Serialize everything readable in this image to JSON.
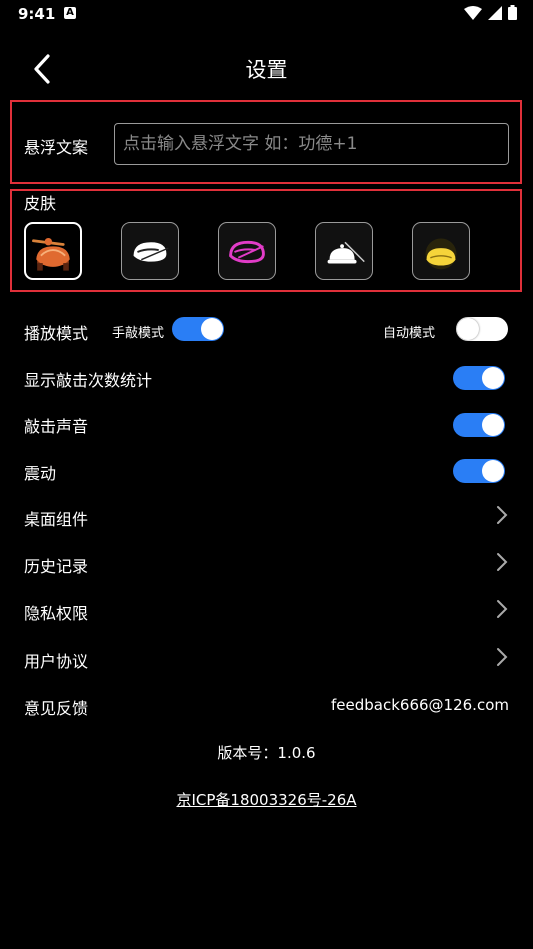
{
  "status_bar": {
    "time": "9:41",
    "badge": "A"
  },
  "header": {
    "title": "设置"
  },
  "float_text": {
    "label": "悬浮文案",
    "placeholder": "点击输入悬浮文字 如：功德+1",
    "value": ""
  },
  "skin": {
    "label": "皮肤",
    "items": [
      {
        "icon": "fish-on-stand-icon",
        "selected": true
      },
      {
        "icon": "white-fish-icon",
        "selected": false
      },
      {
        "icon": "neon-pink-fish-icon",
        "selected": false
      },
      {
        "icon": "bell-with-stick-icon",
        "selected": false
      },
      {
        "icon": "glowing-yellow-fish-icon",
        "selected": false
      }
    ]
  },
  "play_mode": {
    "label": "播放模式",
    "manual_label": "手敲模式",
    "manual_on": true,
    "auto_label": "自动模式",
    "auto_on": false
  },
  "settings": [
    {
      "label": "显示敲击次数统计",
      "on": true
    },
    {
      "label": "敲击声音",
      "on": true
    },
    {
      "label": "震动",
      "on": true
    }
  ],
  "links": [
    {
      "label": "桌面组件"
    },
    {
      "label": "历史记录"
    },
    {
      "label": "隐私权限"
    },
    {
      "label": "用户协议"
    }
  ],
  "feedback": {
    "label": "意见反馈",
    "email": "feedback666@126.com"
  },
  "version": "版本号：1.0.6",
  "icp": "京ICP备18003326号-26A",
  "colors": {
    "accent": "#2a7ef5",
    "highlight_box": "#e0303a",
    "background": "#000000"
  }
}
